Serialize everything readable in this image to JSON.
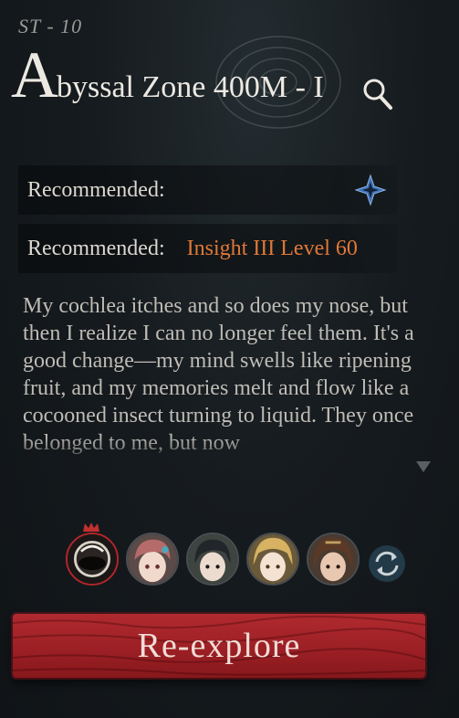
{
  "header": {
    "stage_code": "ST - 10",
    "title_initial": "A",
    "title_rest": "byssal Zone 400M - I"
  },
  "info": {
    "recommended_element_label": "Recommended:",
    "recommended_level_label": "Recommended:",
    "recommended_level_value": "Insight III Level 60"
  },
  "description": {
    "text": "My cochlea itches and so does my nose, but then I realize I can no longer feel them. It's a good change—my mind swells like ripening fruit, and my memories melt and flow like a cocooned insect turning to liquid. They once belonged to me, but now"
  },
  "team": {
    "members": [
      "avatar-leader",
      "avatar-pink-hair",
      "avatar-dark-hair",
      "avatar-blonde",
      "avatar-brown-hair"
    ]
  },
  "actions": {
    "reexplore_label": "Re-explore"
  },
  "colors": {
    "accent_orange": "#e07838",
    "button_red": "#a8262b",
    "element_blue": "#4a7fc0"
  }
}
